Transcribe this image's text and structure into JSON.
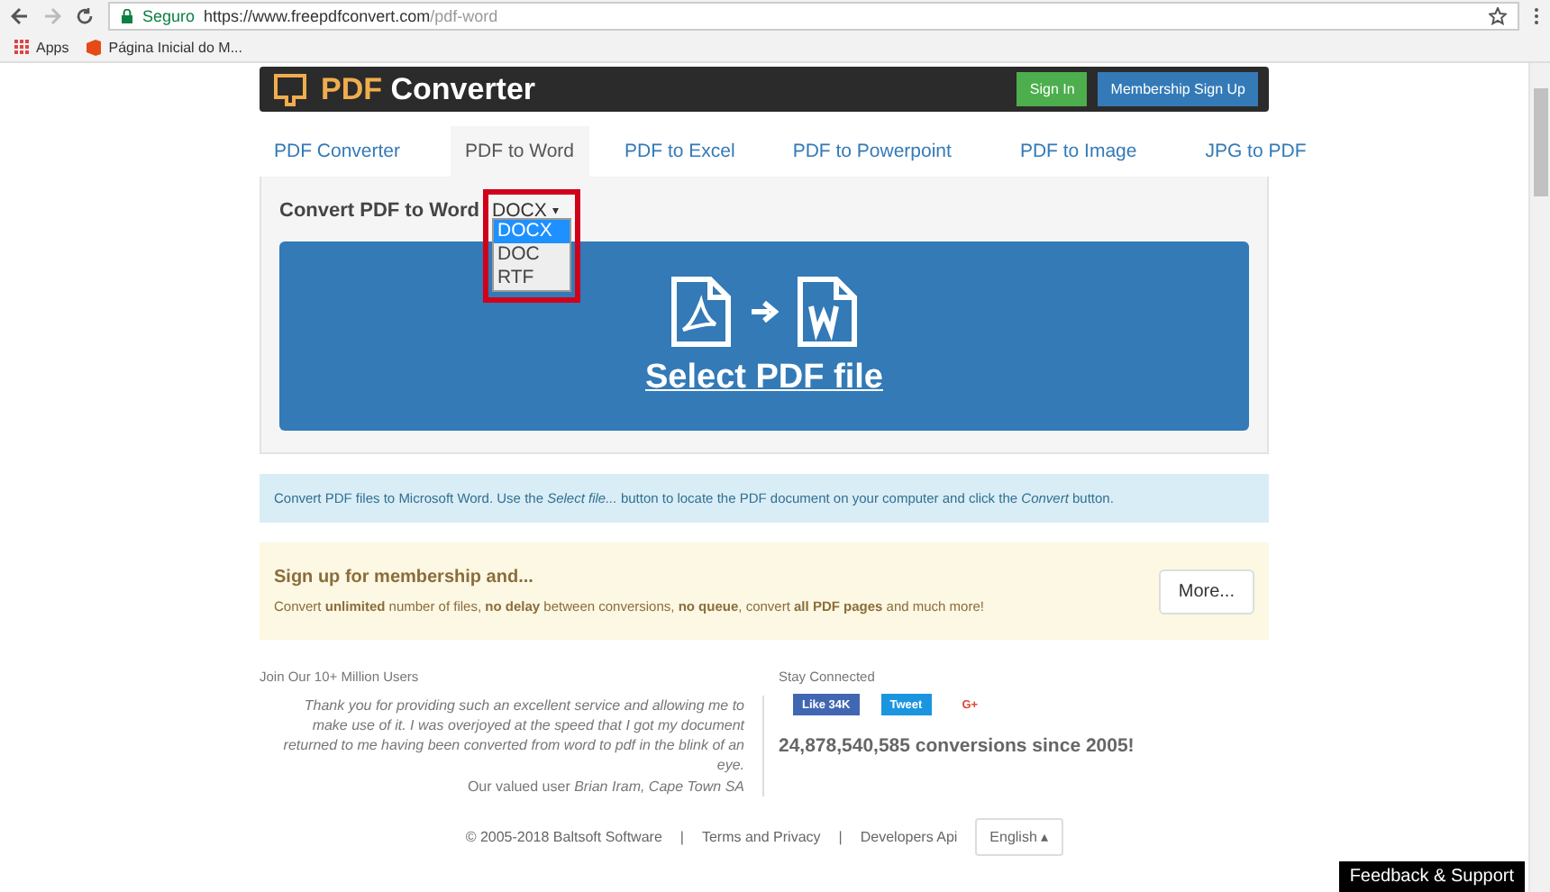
{
  "browser": {
    "secure_label": "Seguro",
    "url_host": "https://www.freepdfconvert.com",
    "url_path": "/pdf-word",
    "bookmarks": [
      {
        "label": "Apps",
        "kind": "apps"
      },
      {
        "label": "Página Inicial do M...",
        "kind": "office"
      }
    ]
  },
  "header": {
    "logo_accent": "PDF",
    "logo_rest": "Converter",
    "buttons": [
      {
        "label": "Sign In",
        "kind": "green"
      },
      {
        "label": "Membership Sign Up",
        "kind": "blue"
      }
    ]
  },
  "tabs": [
    {
      "label": "PDF Converter",
      "selected": false
    },
    {
      "label": "PDF to Word",
      "selected": true
    },
    {
      "label": "PDF to Excel",
      "selected": false
    },
    {
      "label": "PDF to Powerpoint",
      "selected": false
    },
    {
      "label": "PDF to Image",
      "selected": false
    },
    {
      "label": "JPG to PDF",
      "selected": false
    }
  ],
  "converter": {
    "label": "Convert PDF to Word",
    "format_value": "DOCX",
    "format_caret": "▾",
    "dropdown_open": true,
    "options": [
      {
        "label": "DOCX",
        "selected": true
      },
      {
        "label": "DOC",
        "selected": false
      },
      {
        "label": "RTF",
        "selected": false
      }
    ],
    "select_button": "Select PDF file"
  },
  "info": "Convert PDF files to Microsoft Word. Use the *Select file...* button to locate the PDF document on your computer and click the *Convert* button.",
  "membership": {
    "title": "Sign up for membership and...",
    "text": "Convert **unlimited** number of files, **no delay** between conversions, **no queue**, convert **all PDF pages** and much more!",
    "button": "More..."
  },
  "testimonial": {
    "heading": "Join Our 10+ Million Users",
    "quote": "Thank you for providing such an excellent service and allowing me to make use of it. I was overjoyed at the speed that I got my document returned to me having been converted from word to pdf in the blink of an eye.",
    "attribution": "Our valued user *Brian Iram, Cape Town SA*"
  },
  "social": {
    "heading": "Stay Connected",
    "buttons": [
      {
        "label": "Like 34K",
        "kind": "like"
      },
      {
        "label": "Tweet",
        "kind": "tweet"
      },
      {
        "label": "G+",
        "kind": "gplus"
      }
    ],
    "stats": "24,878,540,585 conversions since 2005!"
  },
  "footer": {
    "copyright": "© 2005-2018 Baltsoft Software",
    "separator": "|",
    "links": [
      "Terms and Privacy",
      "Developers Api"
    ],
    "language": "English",
    "language_caret": "▴"
  },
  "feedback": "Feedback & Support"
}
